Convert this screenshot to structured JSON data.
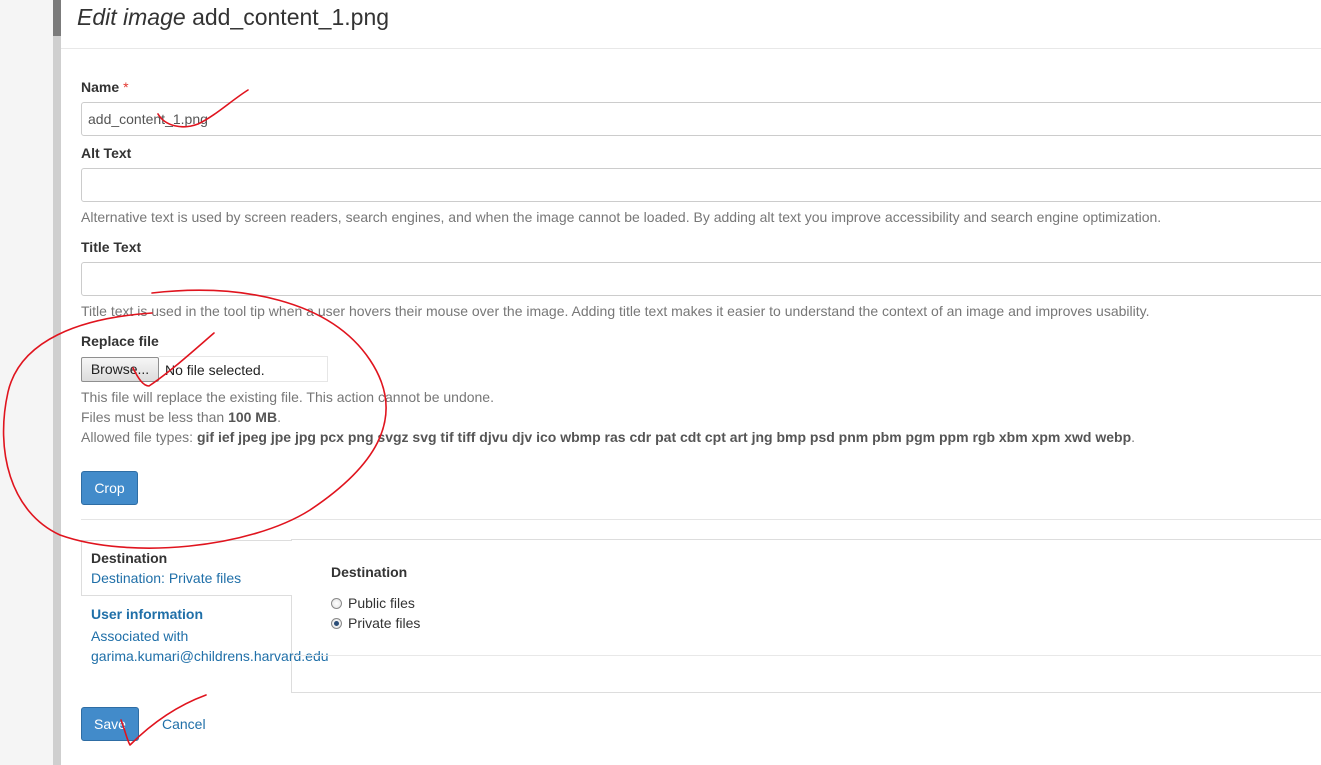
{
  "page_title": {
    "prefix": "Edit image",
    "filename": "add_content_1.png"
  },
  "fields": {
    "name": {
      "label": "Name",
      "required_marker": "*",
      "value": "add_content_1.png"
    },
    "alt_text": {
      "label": "Alt Text",
      "value": "",
      "help": "Alternative text is used by screen readers, search engines, and when the image cannot be loaded. By adding alt text you improve accessibility and search engine optimization."
    },
    "title_text": {
      "label": "Title Text",
      "value": "",
      "help": "Title text is used in the tool tip when a user hovers their mouse over the image. Adding title text makes it easier to understand the context of an image and improves usability."
    },
    "replace_file": {
      "label": "Replace file",
      "browse_label": "Browse...",
      "status": "No file selected.",
      "help_replace": "This file will replace the existing file. This action cannot be undone.",
      "size_prefix": "Files must be less than",
      "size_value": "100 MB",
      "size_suffix": ".",
      "types_prefix": "Allowed file types:",
      "types_value": "gif ief jpeg jpe jpg pcx png svgz svg tif tiff djvu djv ico wbmp ras cdr pat cdt cpt art jng bmp psd pnm pbm pgm ppm rgb xbm xpm xwd webp",
      "types_suffix": "."
    }
  },
  "crop_button": "Crop",
  "vertical_tabs": {
    "destination": {
      "title": "Destination",
      "summary": "Destination: Private files"
    },
    "user_info": {
      "title": "User information",
      "summary": "Associated with garima.kumari@childrens.harvard.edu"
    }
  },
  "destination_pane": {
    "label": "Destination",
    "options": [
      {
        "label": "Public files",
        "checked": false
      },
      {
        "label": "Private files",
        "checked": true
      }
    ]
  },
  "actions": {
    "save": "Save",
    "cancel": "Cancel"
  },
  "colors": {
    "primary": "#428bca",
    "link": "#1f6fa8",
    "required": "#e3372f",
    "annotation": "#e0141e"
  }
}
